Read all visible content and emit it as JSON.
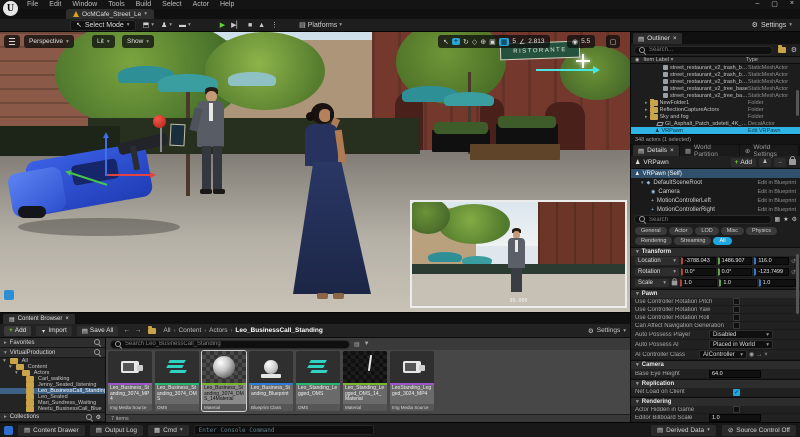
{
  "icons": {
    "caret": "▾",
    "close": "×",
    "min": "–",
    "max": "▢",
    "play": "▶",
    "skip": "▶▏",
    "stop": "■",
    "eject": "▲",
    "dots": "⋮",
    "select": "↖",
    "move": "+",
    "rotate": "↻",
    "scale": "◇",
    "globe": "⊕",
    "surface": "▣",
    "grid": "▦",
    "angle": "∠",
    "camspeed": "◉",
    "star": "★",
    "gear": "⚙",
    "undo": "↺",
    "check": "✓",
    "pawn": "♟",
    "back": "←",
    "fwd": "→",
    "sep": "›",
    "maximize": "▢",
    "chev_r": "▸",
    "chev_d": "▾",
    "component_root": "◆",
    "camera_comp": "◉",
    "controller": "+",
    "doc": "▤",
    "grid2": "▦",
    "cube": "⬒",
    "clapper": "▬",
    "blueprint": "♟",
    "eye": "◉",
    "slash": "⊘"
  },
  "window": {
    "logo": "U",
    "menus": [
      "File",
      "Edit",
      "Window",
      "Tools",
      "Build",
      "Select",
      "Actor",
      "Help"
    ],
    "tab": "OcMCafe_Street_Le"
  },
  "toolbar": {
    "select_mode": "Select Mode",
    "platforms": "Platforms",
    "settings": "Settings"
  },
  "viewport": {
    "perspective": "Perspective",
    "lit": "Lit",
    "show": "Show",
    "grid_snap": "5",
    "rotation_snap": "2.813",
    "camera_speed": "5.5",
    "sign": "RISTORANTE",
    "pip_label": "99.000"
  },
  "outliner": {
    "tab": "Outliner",
    "search_placeholder": "Search...",
    "col_item": "Item Label",
    "col_type": "Type",
    "rows": [
      {
        "label": "street_restaurant_v2_trash_bag06",
        "type": "StaticMeshActor"
      },
      {
        "label": "street_restaurant_v2_trash_bag07",
        "type": "StaticMeshActor"
      },
      {
        "label": "street_restaurant_v2_trash_bag08",
        "type": "StaticMeshActor"
      },
      {
        "label": "street_restaurant_v2_tree_base",
        "type": "StaticMeshActor"
      },
      {
        "label": "street_restaurant_v2_tree_base01",
        "type": "StaticMeshActor"
      },
      {
        "label": "NewFolder1",
        "type": "Folder"
      },
      {
        "label": "ReflectionCaptureActors",
        "type": "Folder"
      },
      {
        "label": "Sky and fog",
        "type": "Folder"
      },
      {
        "label": "GI_Asphalt_Patch_sdeteti_4K_inst2",
        "type": "DecalActor"
      },
      {
        "label": "VRPawn",
        "type": "Edit VRPawn"
      }
    ],
    "status": "348 actors (1 selected)"
  },
  "details": {
    "tab_details": "Details",
    "tab_partition": "World Partition",
    "tab_settings": "World Settings",
    "actor": "VRPawn",
    "add": "Add",
    "components": [
      {
        "label": "VRPawn (Self)",
        "note": ""
      },
      {
        "label": "DefaultSceneRoot",
        "note": "Edit in Blueprint"
      },
      {
        "label": "Camera",
        "note": "Edit in Blueprint"
      },
      {
        "label": "MotionControllerLeft",
        "note": "Edit in Blueprint"
      },
      {
        "label": "MotionControllerRight",
        "note": "Edit in Blueprint"
      }
    ],
    "search_placeholder": "Search",
    "filters": [
      "General",
      "Actor",
      "LOD",
      "Misc",
      "Physics",
      "Rendering",
      "Streaming",
      "All"
    ],
    "transform": {
      "title": "Transform",
      "rows": [
        {
          "label": "Location",
          "x": "-3788.043",
          "y": "1486.907",
          "z": "116.0"
        },
        {
          "label": "Rotation",
          "x": "0.0°",
          "y": "0.0°",
          "z": "-123.7499"
        },
        {
          "label": "Scale",
          "x": "1.0",
          "y": "1.0",
          "z": "1.0"
        }
      ]
    },
    "pawn": {
      "title": "Pawn",
      "checks": [
        "Use Controller Rotation Pitch",
        "Use Controller Rotation Yaw",
        "Use Controller Rotation Roll",
        "Can Affect Navigation Generation"
      ],
      "dropdowns": [
        {
          "label": "Auto Possess Player",
          "value": "Disabled"
        },
        {
          "label": "Auto Possess AI",
          "value": "Placed in World"
        },
        {
          "label": "AI Controller Class",
          "value": "AIController"
        }
      ]
    },
    "camera": {
      "title": "Camera",
      "label": "Base Eye Height",
      "value": "64.0"
    },
    "replication": {
      "title": "Replication",
      "label": "Net Load on Client"
    },
    "rendering": {
      "title": "Rendering",
      "label1": "Actor Hidden in Game",
      "label2": "Editor Billboard Scale",
      "value2": "1.0"
    }
  },
  "content_browser": {
    "tab": "Content Browser",
    "add": "Add",
    "import": "Import",
    "save_all": "Save All",
    "settings": "Settings",
    "breadcrumb": [
      "All",
      "Content",
      "Actors",
      "Leo_BusinessCall_Standing"
    ],
    "favorites": "Favorites",
    "production": "VirtualProduction",
    "collections": "Collections",
    "tree": [
      {
        "label": "All"
      },
      {
        "label": "Content"
      },
      {
        "label": "Actors"
      },
      {
        "label": "Carl_walking"
      },
      {
        "label": "Jenny_Seated_listening"
      },
      {
        "label": "Leo_BusinessCall_Standing"
      },
      {
        "label": "Leo_Seated"
      },
      {
        "label": "Mari_Sundress_Waiting"
      },
      {
        "label": "Neetu_BusinessCall_Blue"
      }
    ],
    "search_placeholder": "Search Leo_BusinessCall_Standing",
    "assets": [
      {
        "name": "Leo_Business_Standing_3074_MP4",
        "type": "Img Media Source"
      },
      {
        "name": "Leo_Business_Standing_3074_OMS",
        "type": "OMS"
      },
      {
        "name": "Leo_Business_Standing_3074_OMS_14Material",
        "type": "Material"
      },
      {
        "name": "Leo_Business_Standing_Blueprint",
        "type": "Blueprint Class"
      },
      {
        "name": "Leo_Standing_Legged_OMS",
        "type": "OMS"
      },
      {
        "name": "Leo_Standing_Legged_OMS_14_Material",
        "type": "Material"
      },
      {
        "name": "LeoStanding_Legged_3024_MP4",
        "type": "Img Media Source"
      }
    ],
    "count": "7 items"
  },
  "status_bar": {
    "content_drawer": "Content Drawer",
    "output_log": "Output Log",
    "cmd": "Cmd",
    "console_placeholder": "Enter Console Command",
    "derived": "Derived Data",
    "source": "Source Control Off"
  }
}
